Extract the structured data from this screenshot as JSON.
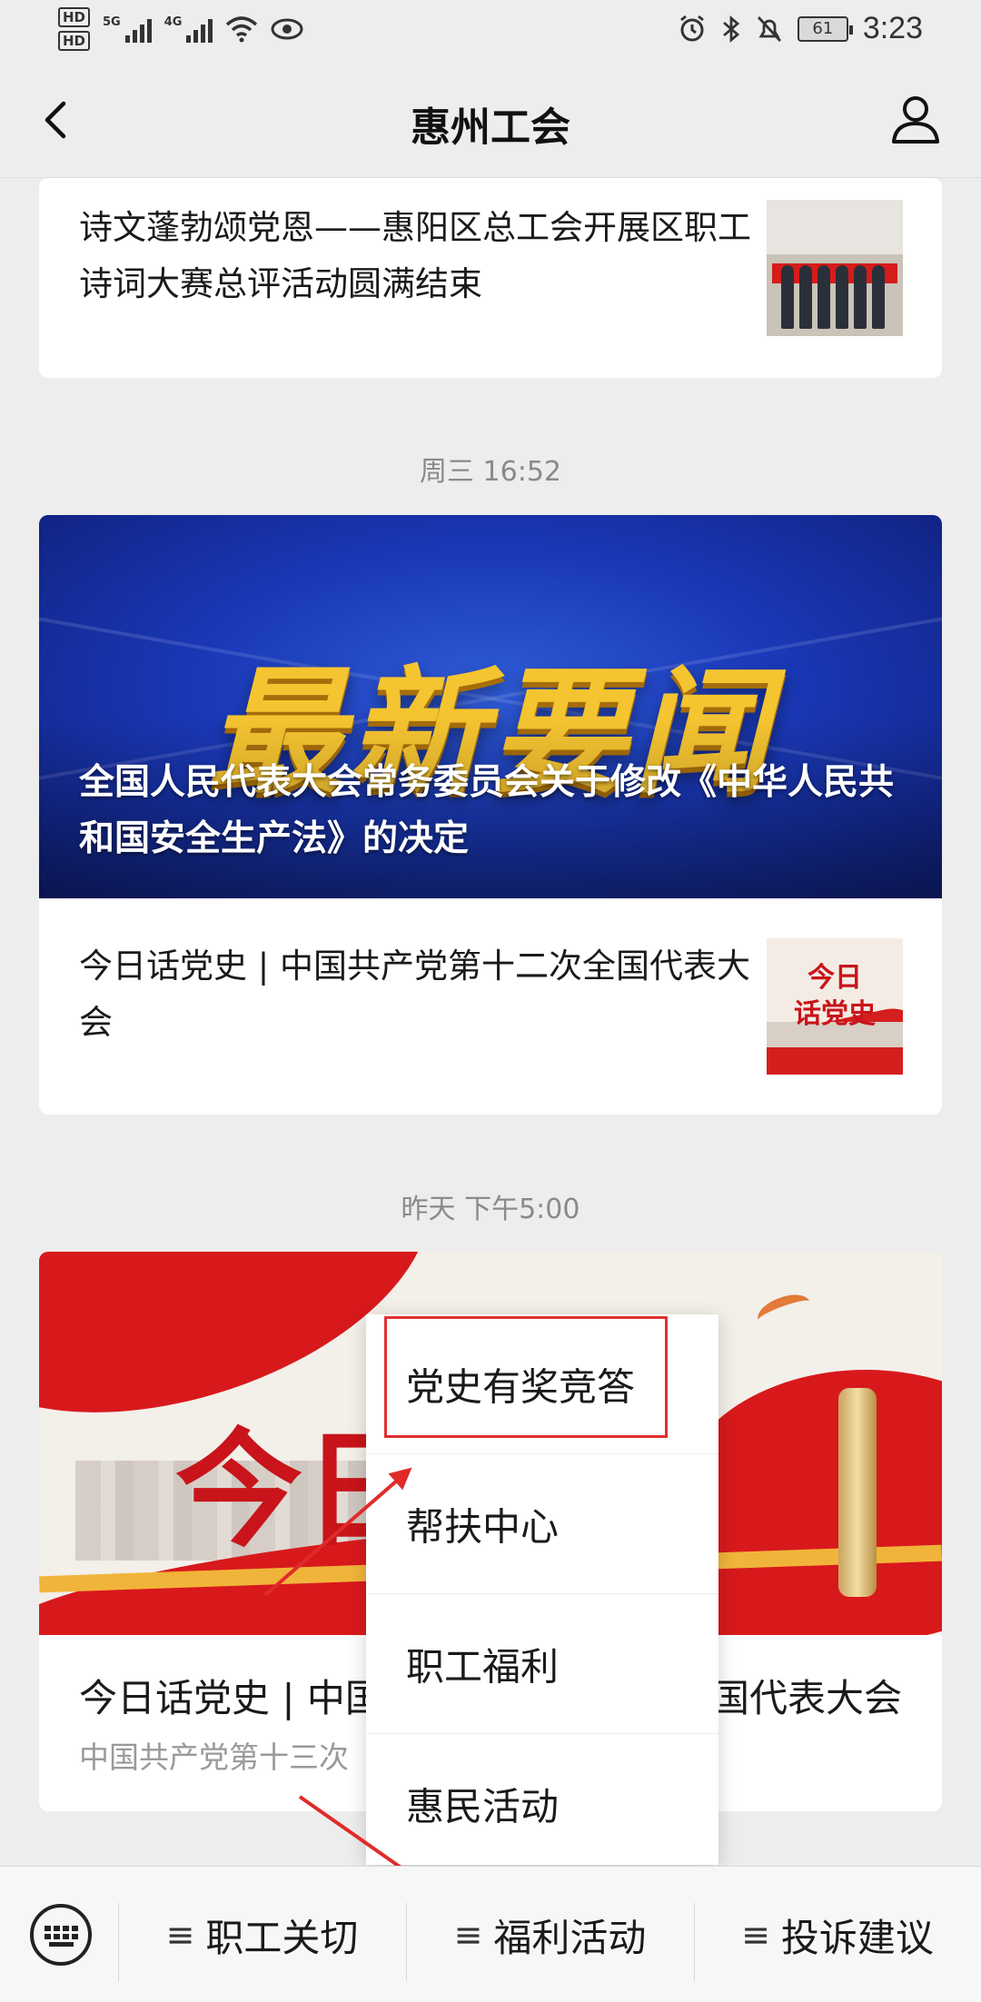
{
  "status_bar": {
    "hd1": "HD",
    "hd2": "HD",
    "net1": "5G",
    "net2": "4G",
    "battery": "61",
    "time": "3:23"
  },
  "nav": {
    "title": "惠州工会",
    "back_icon": "chevron-left-icon",
    "profile_icon": "user-icon"
  },
  "feed": {
    "card1": {
      "article_title": "诗文蓬勃颂党恩——惠阳区总工会开展区职工诗词大赛总评活动圆满结束"
    },
    "date2": "周三 16:52",
    "card2": {
      "cover_big_text": "最新要闻",
      "cover_caption": "全国人民代表大会常务委员会关于修改《中华人民共和国安全生产法》的决定",
      "article_title": "今日话党史 | 中国共产党第十二次全国代表大会",
      "thumb_text_line1": "今日",
      "thumb_text_line2": "话党史"
    },
    "date3": "昨天 下午5:00",
    "card3": {
      "cover_big_char": "今日",
      "title_start": "今日话党史 | 中国",
      "title_end": "国代表大会",
      "summary": "中国共产党第十三次"
    }
  },
  "popup_menu": {
    "items": [
      "党史有奖竞答",
      "帮扶中心",
      "职工福利",
      "惠民活动"
    ],
    "highlight_color": "#e23030"
  },
  "bottom_bar": {
    "keyboard_icon": "keyboard-icon",
    "tabs": [
      {
        "glyph": "≡",
        "label": "职工关切"
      },
      {
        "glyph": "≡",
        "label": "福利活动"
      },
      {
        "glyph": "≡",
        "label": "投诉建议"
      }
    ]
  },
  "colors": {
    "background": "#ededed",
    "annotation_red": "#e02a2a",
    "gold_text": "#f5c431"
  }
}
